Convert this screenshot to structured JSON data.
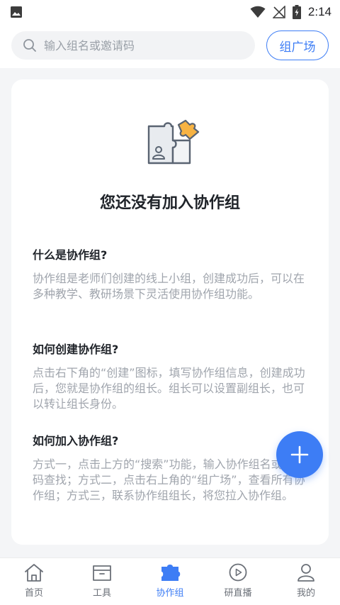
{
  "status_bar": {
    "time": "2:14",
    "icons": [
      "gallery-icon",
      "wifi-icon",
      "no-signal-icon",
      "battery-charging-icon"
    ]
  },
  "header": {
    "search_placeholder": "输入组名或邀请码",
    "search_icon": "search-icon",
    "plaza_button": "组广场"
  },
  "empty_state": {
    "illustration": "puzzle-group-icon",
    "title": "您还没有加入协作组"
  },
  "faq": [
    {
      "question": "什么是协作组?",
      "answer": "协作组是老师们创建的线上小组，创建成功后，可以在多种教学、教研场景下灵活使用协作组功能。"
    },
    {
      "question": "如何创建协作组?",
      "answer": "点击右下角的“创建”图标，填写协作组信息，创建成功后，您就是协作组的组长。组长可以设置副组长，也可以转让组长身份。"
    },
    {
      "question": "如何加入协作组?",
      "answer": "方式一，点击上方的“搜索”功能，输入协作组名或邀请码查找；方式二，点击右上角的“组广场”，查看所有协作组；方式三，联系协作组组长，将您拉入协作组。"
    }
  ],
  "fab": {
    "icon": "plus-icon"
  },
  "bottom_nav": {
    "items": [
      {
        "label": "首页",
        "icon": "home-icon",
        "active": false
      },
      {
        "label": "工具",
        "icon": "toolbox-icon",
        "active": false
      },
      {
        "label": "协作组",
        "icon": "group-icon",
        "active": true
      },
      {
        "label": "研直播",
        "icon": "play-circle-icon",
        "active": false
      },
      {
        "label": "我的",
        "icon": "user-icon",
        "active": false
      }
    ]
  },
  "colors": {
    "accent": "#3d7df5",
    "text_primary": "#1f2329",
    "text_secondary": "#a0a5ad",
    "nav_inactive": "#6b7078",
    "background": "#f4f5f7",
    "illustration_orange": "#f7b343"
  }
}
